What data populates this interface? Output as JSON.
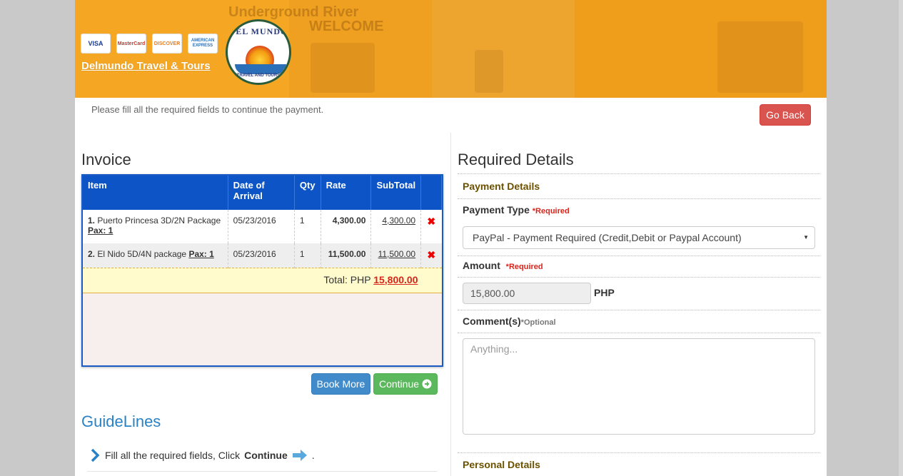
{
  "header": {
    "cards": [
      "VISA",
      "MasterCard",
      "DISCOVER",
      "AMERICAN EXPRESS"
    ],
    "brand_link": "Delmundo Travel & Tours",
    "logo_top": "DEL MUNDO",
    "logo_bottom": "TRAVEL AND TOURS",
    "photo_text_1": "Underground River",
    "photo_text_2": "WELCOME"
  },
  "notice": "Please fill all the required fields to continue the payment.",
  "go_back_label": "Go Back",
  "invoice": {
    "title": "Invoice",
    "columns": [
      "Item",
      "Date of Arrival",
      "Qty",
      "Rate",
      "SubTotal"
    ],
    "rows": [
      {
        "no": "1.",
        "item": "Puerto Princesa 3D/2N Package",
        "pax": "Pax: 1",
        "date": "05/23/2016",
        "qty": "1",
        "rate": "4,300.00",
        "subtotal": "4,300.00",
        "delete": "✖"
      },
      {
        "no": "2.",
        "item": "El Nido 5D/4N package",
        "pax": "Pax: 1",
        "date": "05/23/2016",
        "qty": "1",
        "rate": "11,500.00",
        "subtotal": "11,500.00",
        "delete": "✖"
      }
    ],
    "total_label": "Total: PHP",
    "total_value": "15,800.00"
  },
  "buttons": {
    "book_more": "Book More",
    "continue": "Continue"
  },
  "guidelines": {
    "title": "GuideLines",
    "item_prefix": "Fill all the required fields, Click",
    "item_bold": "Continue",
    "item_suffix": "."
  },
  "required": {
    "title": "Required Details",
    "payment_details": "Payment Details",
    "payment_type_label": "Payment Type",
    "required_tag": "*Required",
    "payment_type_value": "PayPal - Payment Required (Credit,Debit or Paypal Account)",
    "amount_label": "Amount",
    "amount_value": "15,800.00",
    "currency": "PHP",
    "comments_label": "Comment(s)",
    "optional_tag": "*Optional",
    "comments_placeholder": "Anything...",
    "personal_details": "Personal Details"
  },
  "colors": {
    "banner": "#f5a623",
    "table_header": "#0d55c6",
    "danger": "#d9534f",
    "primary": "#428bca",
    "success": "#5cb85c",
    "section_head": "#6b5100"
  }
}
